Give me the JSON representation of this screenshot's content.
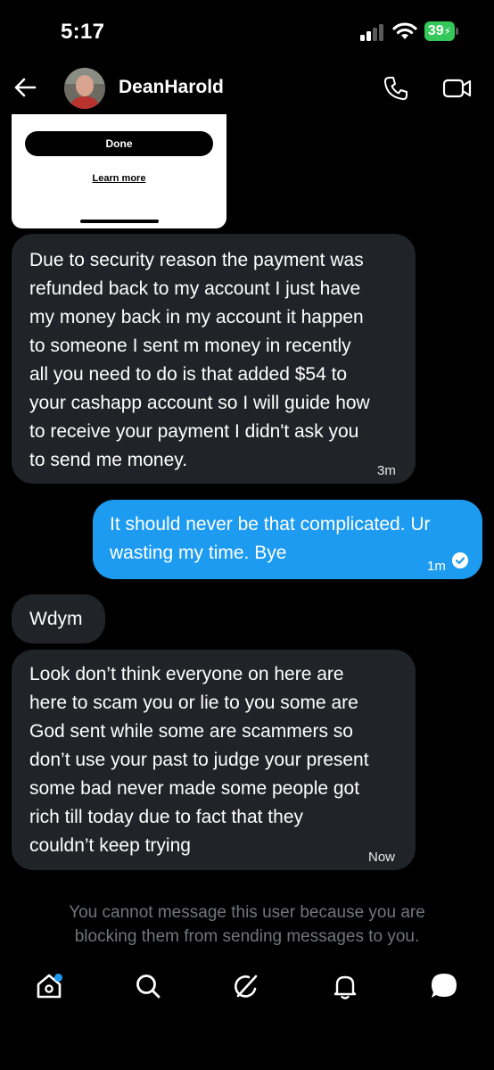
{
  "status_bar": {
    "time": "5:17",
    "battery": "39"
  },
  "conversation": {
    "contact_name": "DeanHarold"
  },
  "card": {
    "button_label": "Done",
    "link_label": "Learn more"
  },
  "messages": [
    {
      "direction": "in",
      "lines": [
        "Due to security reason the payment was",
        "refunded back to my account I just have",
        "my money back in my account it happen",
        "to someone I sent m money in recently",
        "all you need to do is that added $54 to",
        "your cashapp account so I will guide how",
        "to receive your payment I didn't ask you",
        "to send me money."
      ],
      "time": "3m"
    },
    {
      "direction": "out",
      "lines": [
        "It should never be that complicated. Ur",
        "wasting my time. Bye"
      ],
      "time": "1m"
    },
    {
      "direction": "in",
      "lines": [
        "Wdym"
      ],
      "time": ""
    },
    {
      "direction": "in",
      "lines": [
        "Look don’t think everyone on here are",
        "here to scam you or lie to you some are",
        "God sent while some are scammers so",
        "don’t use your past to judge your present",
        "some bad never made some people got",
        "rich till today due to fact that they",
        "couldn’t keep trying"
      ],
      "time": "Now"
    }
  ],
  "notice": {
    "line1": "You cannot message this user because you are",
    "line2": "blocking them from sending messages to you."
  },
  "icons": {
    "back": "arrow-left-icon",
    "phone": "phone-icon",
    "video": "video-camera-icon",
    "home": "home-icon",
    "search": "search-icon",
    "grok": "grok-icon",
    "notifications": "bell-icon",
    "messages": "chat-bubble-icon"
  },
  "colors": {
    "accent": "#1d9bf0",
    "incoming_bubble": "#202327",
    "battery": "#34c759"
  }
}
